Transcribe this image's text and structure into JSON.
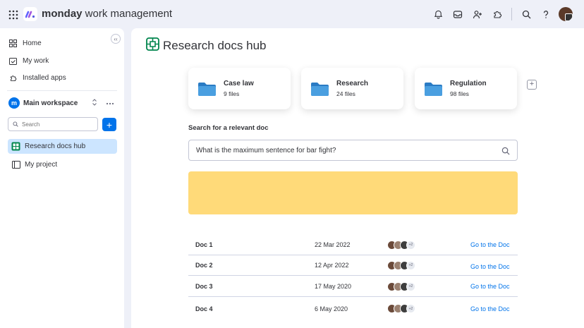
{
  "topbar": {
    "brand_bold": "monday",
    "brand_rest": " work management"
  },
  "sidebar": {
    "collapse": "‹‹",
    "nav": [
      {
        "label": "Home"
      },
      {
        "label": "My work"
      },
      {
        "label": "Installed apps"
      }
    ],
    "workspace": {
      "badge": "m",
      "name": "Main workspace"
    },
    "search": {
      "placeholder": "Search"
    },
    "add_label": "+",
    "boards": [
      {
        "label": "Research docs hub",
        "active": true
      },
      {
        "label": "My project",
        "active": false
      }
    ]
  },
  "main": {
    "title": "Research docs hub",
    "folders": [
      {
        "name": "Case law",
        "count": "9 files"
      },
      {
        "name": "Research",
        "count": "24 files"
      },
      {
        "name": "Regulation",
        "count": "98 files"
      }
    ],
    "add_folder": "+",
    "search_label": "Search for a relevant doc",
    "search_value": "What is the maximum sentence for bar fight?",
    "docs": [
      {
        "name": "Doc 1",
        "date": "22 Mar 2022",
        "extra": "+2",
        "link": "Go to the Doc"
      },
      {
        "name": "Doc 2",
        "date": "12 Apr 2022",
        "extra": "+2",
        "link": "Go to the Doc"
      },
      {
        "name": "Doc 3",
        "date": "17 May 2020",
        "extra": "+2",
        "link": "Go to the Doc"
      },
      {
        "name": "Doc 4",
        "date": "6 May 2020",
        "extra": "+2",
        "link": "Go to the Doc"
      }
    ]
  },
  "colors": {
    "accent": "#0073ea",
    "highlight": "#ffda79",
    "active_board": "#cce5ff",
    "folder": "#4a9fe0"
  }
}
